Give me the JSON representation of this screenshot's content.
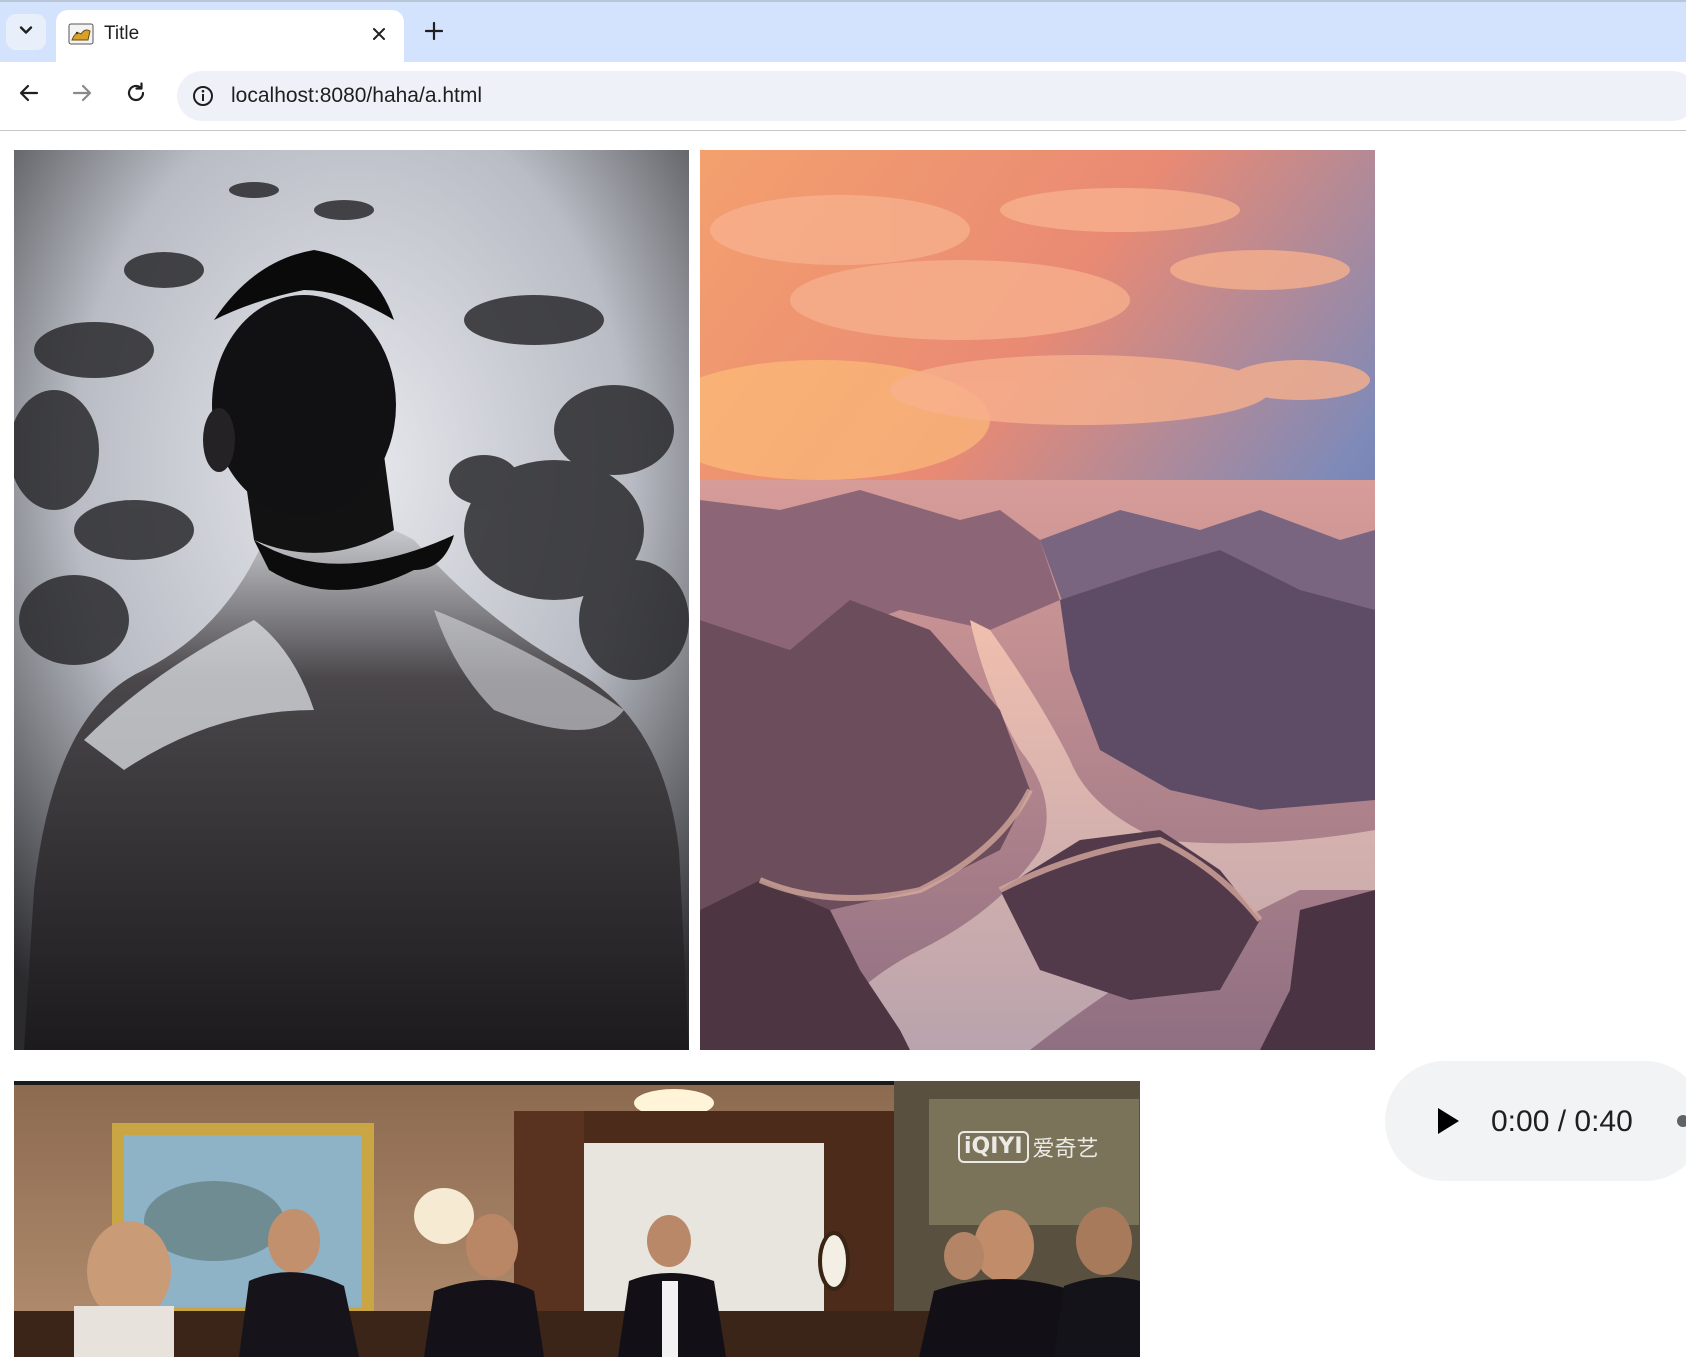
{
  "browser": {
    "tab": {
      "title": "Title",
      "favicon": "tomcat-icon"
    },
    "address_bar": {
      "url": "localhost:8080/haha/a.html",
      "site_info_icon": "info-icon"
    },
    "icons": {
      "tab_search": "chevron-down-icon",
      "close_tab": "close-icon",
      "new_tab": "plus-icon",
      "back": "arrow-left-icon",
      "forward": "arrow-right-icon",
      "reload": "reload-icon"
    },
    "colors": {
      "tabstrip": "#d3e3fd",
      "omnibox": "#eef1f8"
    }
  },
  "page": {
    "images": [
      {
        "name": "man-in-coat-photo",
        "description_color": "#3a3a3a"
      },
      {
        "name": "river-canyon-sunset-photo",
        "description_color": "#b3788a"
      }
    ],
    "audio": {
      "current_time": "0:00",
      "separator": "/",
      "duration": "0:40",
      "time_display": "0:00 / 0:40",
      "play_icon": "play-icon"
    },
    "video": {
      "watermark_logo": "iQIYI",
      "watermark_text": "爱奇艺"
    }
  }
}
